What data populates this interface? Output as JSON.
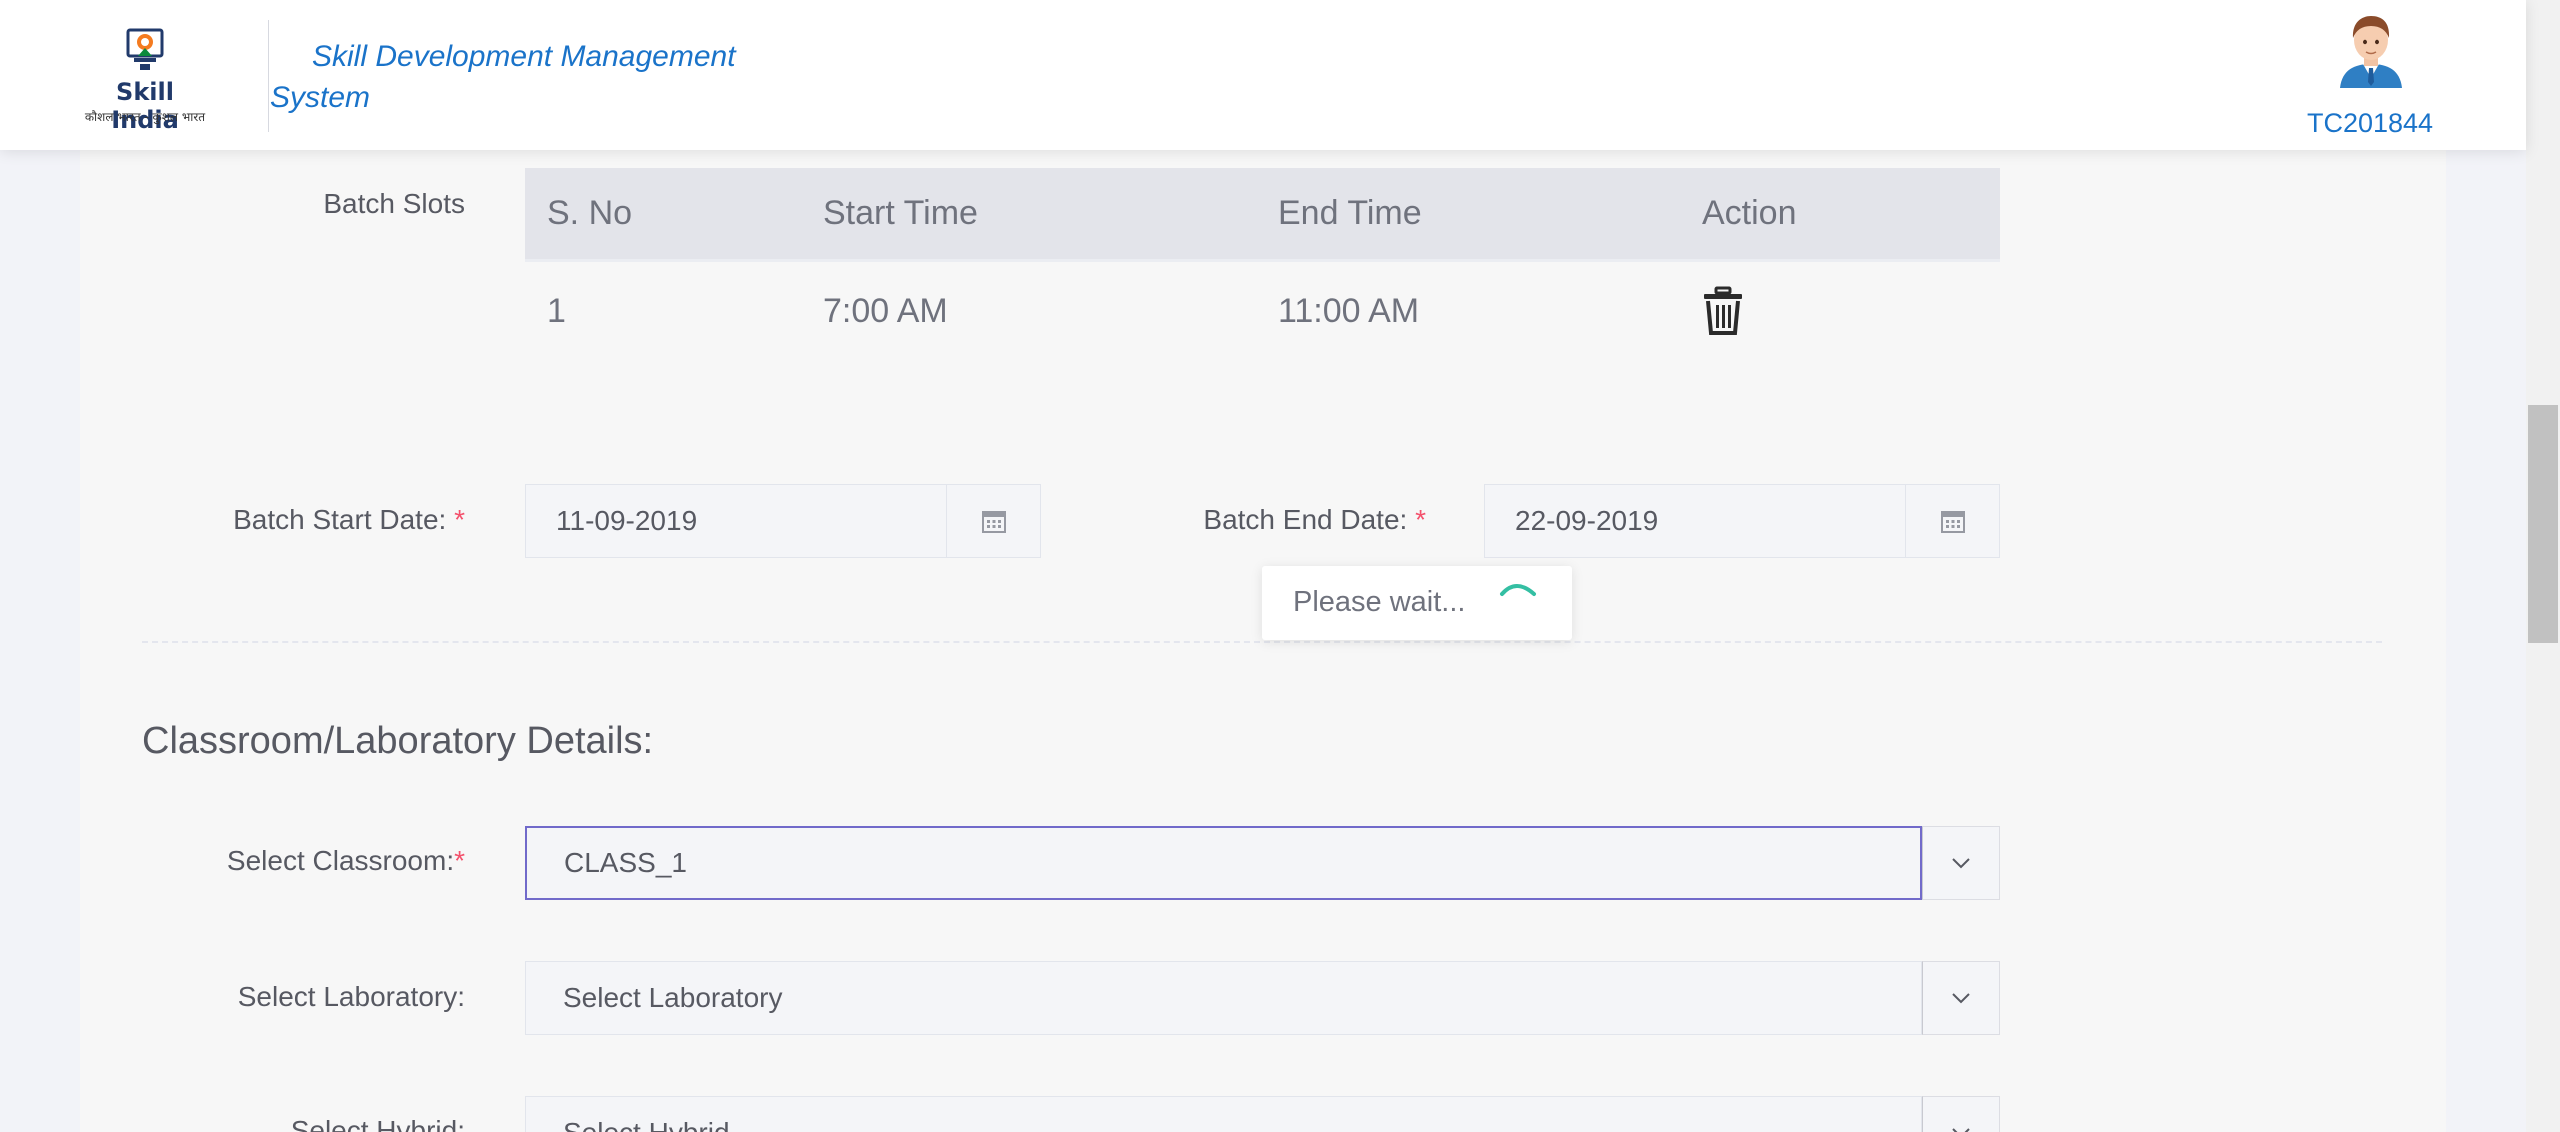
{
  "header": {
    "brand": "Skill India",
    "brand_tagline": "कौशल भारत - कुशल भारत",
    "app_title": "Skill Development Management System",
    "user_id": "TC201844"
  },
  "batch_slots": {
    "label": "Batch Slots",
    "columns": [
      "S. No",
      "Start Time",
      "End Time",
      "Action"
    ],
    "rows": [
      {
        "sno": "1",
        "start": "7:00 AM",
        "end": "11:00 AM",
        "action_icon": "trash-icon"
      }
    ]
  },
  "dates": {
    "start_label": "Batch Start Date:",
    "start_value": "11-09-2019",
    "end_label": "Batch End Date:",
    "end_value": "22-09-2019",
    "required_mark": "*"
  },
  "loading": {
    "text": "Please wait..."
  },
  "classroom_section": {
    "title": "Classroom/Laboratory Details:",
    "classroom_label": "Select Classroom:",
    "classroom_value": "CLASS_1",
    "laboratory_label": "Select Laboratory:",
    "laboratory_value": "Select Laboratory",
    "hybrid_label": "Select Hybrid:",
    "hybrid_value": "Select Hybrid"
  },
  "colors": {
    "accent": "#1a73c9",
    "required": "#f4516c",
    "focus_border": "#716aca",
    "spinner": "#34bfa3"
  }
}
